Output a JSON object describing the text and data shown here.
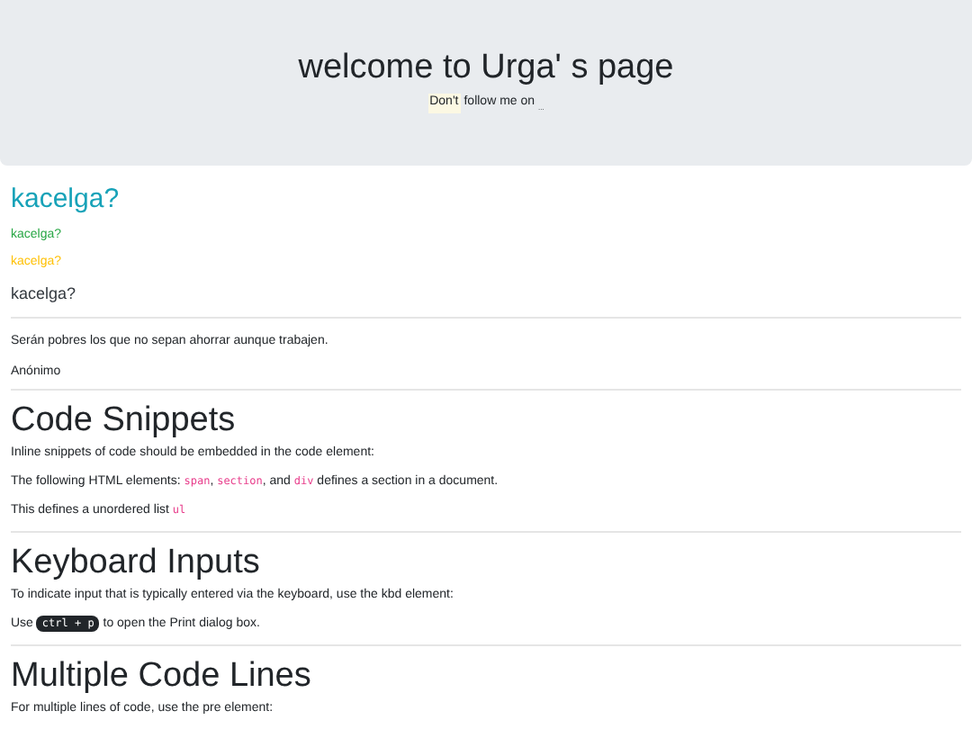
{
  "header": {
    "title": "welcome to Urga' s page",
    "tagline": {
      "highlight": "Don't",
      "text": "follow me on",
      "link": "..."
    }
  },
  "headings": [
    {
      "text": "kacelga?",
      "kind": "large",
      "color": "#17a2b8"
    },
    {
      "text": "kacelga?",
      "kind": "small",
      "color": "#28a745"
    },
    {
      "text": "kacelga?",
      "kind": "small",
      "color": "#ffc107"
    },
    {
      "text": "kacelga?",
      "kind": "medium",
      "color": "#343a40"
    }
  ],
  "quote": {
    "text": "Serán pobres los que no sepan ahorrar aunque trabajen.",
    "author": "Anónimo"
  },
  "sections": [
    {
      "title": "Code Snippets",
      "paragraphs": [
        [
          {
            "kind": "text",
            "text": "Inline snippets of code should be embedded in the code element:"
          }
        ],
        [
          {
            "kind": "text",
            "text": "The following HTML elements: "
          },
          {
            "kind": "code",
            "text": "span"
          },
          {
            "kind": "text",
            "text": ", "
          },
          {
            "kind": "code",
            "text": "section"
          },
          {
            "kind": "text",
            "text": ", and "
          },
          {
            "kind": "code",
            "text": "div"
          },
          {
            "kind": "text",
            "text": " defines a section in a document."
          }
        ],
        [
          {
            "kind": "text",
            "text": "This defines a unordered list "
          },
          {
            "kind": "code",
            "text": "ul"
          }
        ]
      ]
    },
    {
      "title": "Keyboard Inputs",
      "paragraphs": [
        [
          {
            "kind": "text",
            "text": "To indicate input that is typically entered via the keyboard, use the kbd element:"
          }
        ],
        [
          {
            "kind": "text",
            "text": "Use "
          },
          {
            "kind": "kbd",
            "text": "ctrl + p"
          },
          {
            "kind": "text",
            "text": " to open the Print dialog box."
          }
        ]
      ]
    },
    {
      "title": "Multiple Code Lines",
      "paragraphs": [
        [
          {
            "kind": "text",
            "text": "For multiple lines of code, use the pre element:"
          }
        ]
      ]
    }
  ]
}
